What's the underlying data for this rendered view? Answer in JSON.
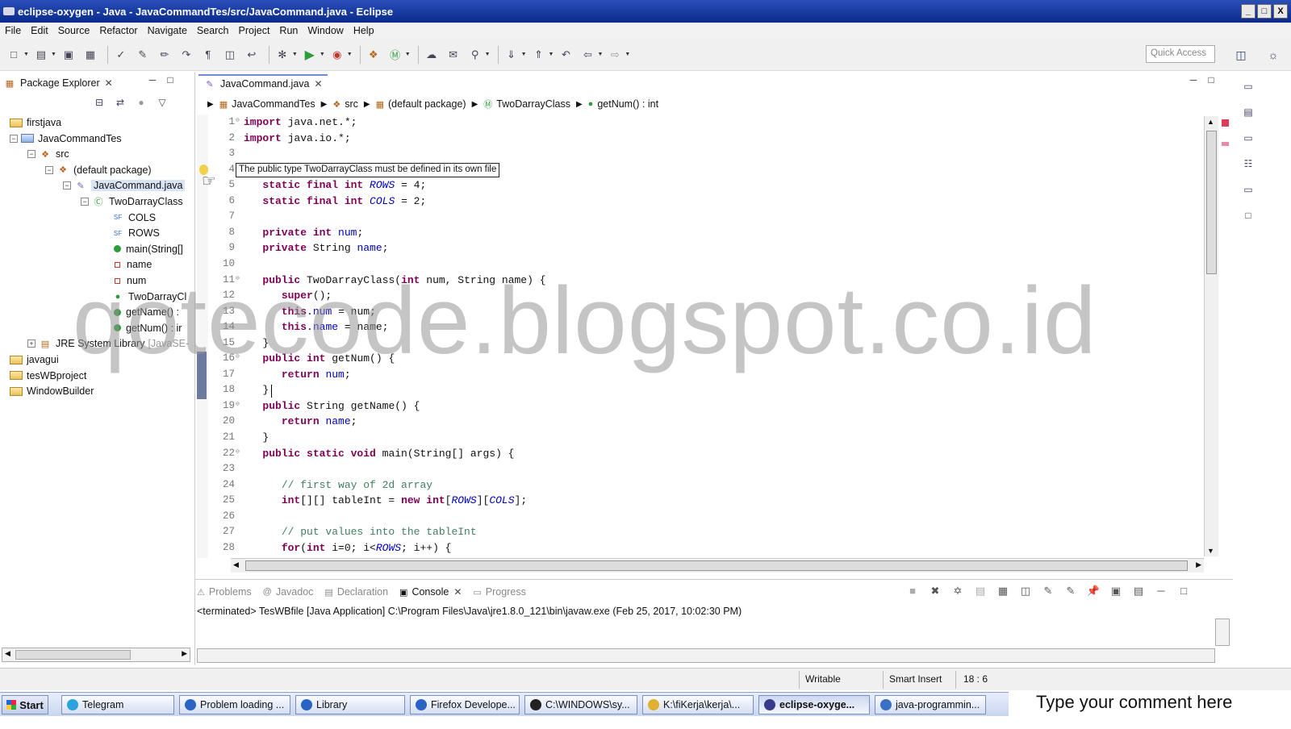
{
  "window": {
    "title": "eclipse-oxygen - Java - JavaCommandTes/src/JavaCommand.java - Eclipse",
    "controls": [
      "_",
      "□",
      "X"
    ]
  },
  "menu": [
    "File",
    "Edit",
    "Source",
    "Refactor",
    "Navigate",
    "Search",
    "Project",
    "Run",
    "Window",
    "Help"
  ],
  "toolbar": {
    "quick_access_placeholder": "Quick Access"
  },
  "package_explorer": {
    "tab_label": "Package Explorer",
    "tree": [
      {
        "label": "firstjava",
        "depth": 0,
        "icon": "project-folder-icon",
        "expander": ""
      },
      {
        "label": "JavaCommandTes",
        "depth": 0,
        "icon": "project-icon",
        "expander": "−"
      },
      {
        "label": "src",
        "depth": 1,
        "icon": "package-folder-icon",
        "expander": "−"
      },
      {
        "label": "(default package)",
        "depth": 2,
        "icon": "package-icon",
        "expander": "−"
      },
      {
        "label": "JavaCommand.java",
        "depth": 3,
        "icon": "java-file-icon",
        "expander": "−",
        "selected": true
      },
      {
        "label": "TwoDarrayClass",
        "depth": 4,
        "icon": "class-icon",
        "expander": "−"
      },
      {
        "label": "COLS",
        "depth": 5,
        "icon": "static-field-icon",
        "expander": ""
      },
      {
        "label": "ROWS",
        "depth": 5,
        "icon": "static-field-icon",
        "expander": ""
      },
      {
        "label": "main(String[]",
        "depth": 5,
        "icon": "public-method-icon",
        "expander": ""
      },
      {
        "label": "name",
        "depth": 5,
        "icon": "private-field-icon",
        "expander": ""
      },
      {
        "label": "num",
        "depth": 5,
        "icon": "private-field-icon",
        "expander": ""
      },
      {
        "label": "TwoDarrayCl",
        "depth": 5,
        "icon": "constructor-icon",
        "expander": ""
      },
      {
        "label": "getName() :",
        "depth": 5,
        "icon": "public-method-icon",
        "expander": ""
      },
      {
        "label": "getNum() : ir",
        "depth": 5,
        "icon": "public-method-icon",
        "expander": ""
      },
      {
        "label": "JRE System Library",
        "suffix": "[JavaSE-",
        "depth": 1,
        "icon": "library-icon",
        "expander": "+"
      },
      {
        "label": "javagui",
        "depth": 0,
        "icon": "project-folder-icon",
        "expander": ""
      },
      {
        "label": "tesWBproject",
        "depth": 0,
        "icon": "project-folder-icon",
        "expander": ""
      },
      {
        "label": "WindowBuilder",
        "depth": 0,
        "icon": "project-folder-icon",
        "expander": ""
      }
    ]
  },
  "editor": {
    "tab_label": "JavaCommand.java",
    "breadcrumb": [
      "JavaCommandTes",
      "src",
      "(default package)",
      "TwoDarrayClass",
      "getNum() : int"
    ],
    "tooltip": "The public type TwoDarrayClass must be defined in its own file",
    "lines": [
      {
        "n": "1",
        "fold": "⊖",
        "tokens": [
          [
            "kw",
            "import"
          ],
          [
            "",
            "java.net.*;"
          ]
        ]
      },
      {
        "n": "2",
        "fold": "",
        "tokens": [
          [
            "kw",
            "import"
          ],
          [
            "",
            "java.io.*;"
          ]
        ]
      },
      {
        "n": "3",
        "fold": "",
        "tokens": []
      },
      {
        "n": "4",
        "fold": "",
        "tokens": []
      },
      {
        "n": "5",
        "fold": "",
        "tokens": [
          [
            "",
            "   "
          ],
          [
            "kw",
            "static final int"
          ],
          [
            "sfld",
            "ROWS"
          ],
          [
            "",
            "= 4;"
          ]
        ]
      },
      {
        "n": "6",
        "fold": "",
        "tokens": [
          [
            "",
            "   "
          ],
          [
            "kw",
            "static final int"
          ],
          [
            "sfld",
            "COLS"
          ],
          [
            "",
            "= 2;"
          ]
        ]
      },
      {
        "n": "7",
        "fold": "",
        "tokens": []
      },
      {
        "n": "8",
        "fold": "",
        "tokens": [
          [
            "",
            "   "
          ],
          [
            "kw",
            "private int"
          ],
          [
            "fld",
            "num"
          ],
          [
            "",
            ";"
          ]
        ]
      },
      {
        "n": "9",
        "fold": "",
        "tokens": [
          [
            "",
            "   "
          ],
          [
            "kw",
            "private"
          ],
          [
            "",
            "String"
          ],
          [
            "fld",
            "name"
          ],
          [
            "",
            ";"
          ]
        ]
      },
      {
        "n": "10",
        "fold": "",
        "tokens": []
      },
      {
        "n": "11",
        "fold": "⊖",
        "tokens": [
          [
            "",
            "   "
          ],
          [
            "kw",
            "public"
          ],
          [
            "",
            "TwoDarrayClass("
          ],
          [
            "kw",
            "int"
          ],
          [
            "",
            "num, String name) {"
          ]
        ]
      },
      {
        "n": "12",
        "fold": "",
        "tokens": [
          [
            "",
            "      "
          ],
          [
            "kw",
            "super"
          ],
          [
            "",
            "();"
          ]
        ]
      },
      {
        "n": "13",
        "fold": "",
        "tokens": [
          [
            "",
            "      "
          ],
          [
            "kw",
            "this"
          ],
          [
            "",
            "."
          ],
          [
            "fld",
            "num"
          ],
          [
            "",
            "= num;"
          ]
        ]
      },
      {
        "n": "14",
        "fold": "",
        "tokens": [
          [
            "",
            "      "
          ],
          [
            "kw",
            "this"
          ],
          [
            "",
            "."
          ],
          [
            "fld",
            "name"
          ],
          [
            "",
            "= name;"
          ]
        ]
      },
      {
        "n": "15",
        "fold": "",
        "tokens": [
          [
            "",
            "   }"
          ]
        ]
      },
      {
        "n": "16",
        "fold": "⊖",
        "tokens": [
          [
            "",
            "   "
          ],
          [
            "kw",
            "public int"
          ],
          [
            "",
            "getNum() {"
          ]
        ]
      },
      {
        "n": "17",
        "fold": "",
        "tokens": [
          [
            "",
            "      "
          ],
          [
            "kw",
            "return"
          ],
          [
            "fld",
            "num"
          ],
          [
            "",
            ";"
          ]
        ]
      },
      {
        "n": "18",
        "fold": "",
        "tokens": [
          [
            "",
            "   }"
          ]
        ]
      },
      {
        "n": "19",
        "fold": "⊖",
        "tokens": [
          [
            "",
            "   "
          ],
          [
            "kw",
            "public"
          ],
          [
            "",
            "String getName() {"
          ]
        ]
      },
      {
        "n": "20",
        "fold": "",
        "tokens": [
          [
            "",
            "      "
          ],
          [
            "kw",
            "return"
          ],
          [
            "fld",
            "name"
          ],
          [
            "",
            ";"
          ]
        ]
      },
      {
        "n": "21",
        "fold": "",
        "tokens": [
          [
            "",
            "   }"
          ]
        ]
      },
      {
        "n": "22",
        "fold": "⊖",
        "tokens": [
          [
            "",
            "   "
          ],
          [
            "kw",
            "public static void"
          ],
          [
            "",
            "main(String[] args) {"
          ]
        ]
      },
      {
        "n": "23",
        "fold": "",
        "tokens": []
      },
      {
        "n": "24",
        "fold": "",
        "tokens": [
          [
            "",
            "      "
          ],
          [
            "cmt",
            "// first way of 2d array"
          ]
        ]
      },
      {
        "n": "25",
        "fold": "",
        "tokens": [
          [
            "",
            "      "
          ],
          [
            "kw",
            "int"
          ],
          [
            "",
            "[][] tableInt ="
          ],
          [
            "kw",
            "new int"
          ],
          [
            "",
            "["
          ],
          [
            "sfld",
            "ROWS"
          ],
          [
            "",
            "]["
          ],
          [
            "sfld",
            "COLS"
          ],
          [
            "",
            "];"
          ]
        ]
      },
      {
        "n": "26",
        "fold": "",
        "tokens": []
      },
      {
        "n": "27",
        "fold": "",
        "tokens": [
          [
            "",
            "      "
          ],
          [
            "cmt",
            "// put values into the tableInt"
          ]
        ]
      },
      {
        "n": "28",
        "fold": "",
        "tokens": [
          [
            "",
            "      "
          ],
          [
            "kw",
            "for"
          ],
          [
            "",
            "("
          ],
          [
            "kw",
            "int"
          ],
          [
            "",
            "i=0; i<"
          ],
          [
            "sfld",
            "ROWS"
          ],
          [
            "",
            "; i++) {"
          ]
        ]
      }
    ]
  },
  "bottom_panel": {
    "tabs": [
      {
        "label": "Problems",
        "icon": "problems-icon",
        "active": false
      },
      {
        "label": "Javadoc",
        "icon": "javadoc-icon",
        "active": false
      },
      {
        "label": "Declaration",
        "icon": "declaration-icon",
        "active": false
      },
      {
        "label": "Console",
        "icon": "console-icon",
        "active": true
      },
      {
        "label": "Progress",
        "icon": "progress-icon",
        "active": false
      }
    ],
    "console_line": "<terminated> TesWBfile [Java Application] C:\\Program Files\\Java\\jre1.8.0_121\\bin\\javaw.exe (Feb 25, 2017, 10:02:30 PM)"
  },
  "status": {
    "writable": "Writable",
    "insert_mode": "Smart Insert",
    "position": "18 : 6"
  },
  "taskbar": {
    "start": "Start",
    "tasks": [
      {
        "label": "Telegram",
        "color": "#2aa3de"
      },
      {
        "label": "Problem loading ...",
        "color": "#2a62c6"
      },
      {
        "label": "Library",
        "color": "#2a62c6"
      },
      {
        "label": "Firefox Develope...",
        "color": "#2a62c6"
      },
      {
        "label": "C:\\WINDOWS\\sy...",
        "color": "#222222"
      },
      {
        "label": "K:\\fiKerja\\kerja\\...",
        "color": "#e0b030"
      },
      {
        "label": "eclipse-oxyge...",
        "color": "#3a3a8c",
        "active": true
      },
      {
        "label": "java-programmin...",
        "color": "#3a6fc6"
      }
    ],
    "comment_prompt": "Type your comment here"
  },
  "watermark": "qotecode.blogspot.co.id"
}
